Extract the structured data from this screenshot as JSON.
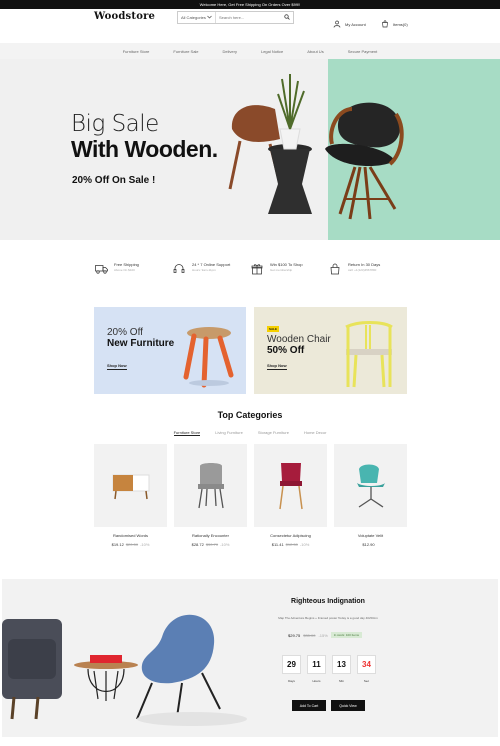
{
  "topbar": {
    "announcement": "Welcome Here, Get Free Shipping On Orders Over $99!!"
  },
  "header": {
    "logo": "Woodstore",
    "search": {
      "category": "All Categories",
      "placeholder": "Search here..."
    },
    "account_label": "My Account",
    "cart_label": "Items(0)"
  },
  "nav": {
    "items": [
      "Furniture Store",
      "Furniture Sale",
      "Delivery",
      "Legal Notice",
      "About Us",
      "Secure Payment"
    ]
  },
  "hero": {
    "line1": "Big Sale",
    "line2": "With Wooden.",
    "line3": "20% Off On Sale !",
    "mint_color": "#a7dcc5"
  },
  "services": [
    {
      "icon": "truck-icon",
      "title": "Free Shipping",
      "sub": "Above On $100"
    },
    {
      "icon": "headset-icon",
      "title": "24 * 7 Online Support",
      "sub": "Hours: 9am-11pm"
    },
    {
      "icon": "gift-icon",
      "title": "Win $100 To Shop",
      "sub": "Get membership"
    },
    {
      "icon": "return-bag-icon",
      "title": "Return In 30 Days",
      "sub": "call: +1(123)4567890"
    }
  ],
  "banners": {
    "left": {
      "small": "20% Off",
      "big": "New Furniture",
      "link": "Shop Now"
    },
    "right": {
      "badge": "SALE",
      "small": "Wooden Chair",
      "big": "50% Off",
      "link": "Shop Now"
    }
  },
  "top_categories": {
    "title": "Top Categories",
    "tabs": [
      "Furniture Store",
      "Living Furniture",
      "Storage Furniture",
      "Home Decor"
    ],
    "products": [
      {
        "name": "Randomised Words",
        "price": "$19.12",
        "old": "$20.50",
        "off": "-10%"
      },
      {
        "name": "Rationally Encounter",
        "price": "$28.72",
        "old": "$30.70",
        "off": "-10%"
      },
      {
        "name": "Consectetur Adipiscing",
        "price": "$11.41",
        "old": "$12.50",
        "off": "-10%"
      },
      {
        "name": "Voluptate Velit",
        "price": "$12.90",
        "old": "",
        "off": ""
      }
    ]
  },
  "deal": {
    "title": "Righteous Indignation",
    "desc": "Map The Adventure Begins + Framed poster Today is a good day 40x50cm",
    "price": "$29.75",
    "old": "$35.00",
    "off": "-15%",
    "stock": "In stock: 100 Items",
    "countdown": [
      {
        "value": "29",
        "label": "Days"
      },
      {
        "value": "11",
        "label": "Hours"
      },
      {
        "value": "13",
        "label": "Min"
      },
      {
        "value": "34",
        "label": "Sec"
      }
    ],
    "add_to_cart": "Add To Cart",
    "quick_view": "Quick View"
  }
}
